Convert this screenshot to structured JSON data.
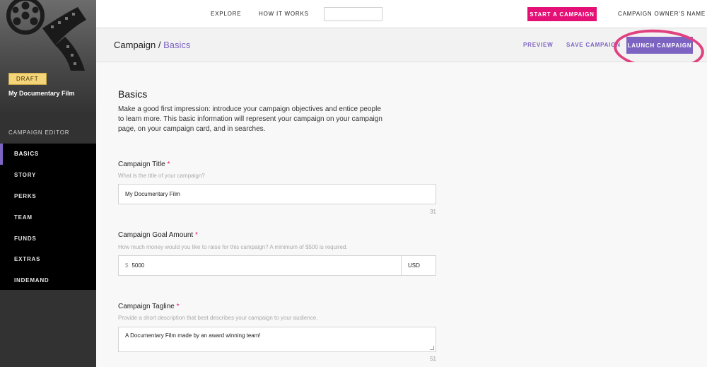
{
  "sidebar": {
    "status_badge": "DRAFT",
    "campaign_name": "My Documentary Film",
    "editor_heading": "CAMPAIGN EDITOR",
    "items": [
      {
        "label": "BASICS",
        "active": true
      },
      {
        "label": "STORY",
        "active": false
      },
      {
        "label": "PERKS",
        "active": false
      },
      {
        "label": "TEAM",
        "active": false
      },
      {
        "label": "FUNDS",
        "active": false
      },
      {
        "label": "EXTRAS",
        "active": false
      },
      {
        "label": "INDEMAND",
        "active": false
      }
    ]
  },
  "topbar": {
    "explore": "EXPLORE",
    "how_it_works": "HOW IT WORKS",
    "search_value": "",
    "start_campaign": "START A CAMPAIGN",
    "owner_name": "CAMPAIGN OWNER'S NAME"
  },
  "subheader": {
    "crumb_root": "Campaign",
    "crumb_sep": " / ",
    "crumb_current": "Basics",
    "preview": "PREVIEW",
    "save": "SAVE CAMPAIGN",
    "launch": "LAUNCH CAMPAIGN"
  },
  "main": {
    "title": "Basics",
    "description": "Make a good first impression: introduce your campaign objectives and entice people to learn more. This basic information will represent your campaign on your campaign page, on your campaign card, and in searches.",
    "fields": {
      "title": {
        "label": "Campaign Title",
        "required": "*",
        "help": "What is the title of your campaign?",
        "value": "My Documentary Film",
        "counter": "31"
      },
      "goal": {
        "label": "Campaign Goal Amount",
        "required": "*",
        "help": "How much money would you like to raise for this campaign? A minimum of $500 is required.",
        "currency_symbol": "$",
        "value": "5000",
        "currency": "USD"
      },
      "tagline": {
        "label": "Campaign Tagline",
        "required": "*",
        "help": "Provide a short description that best describes your campaign to your audience.",
        "value": "A Documentary Film made by an award winning team!",
        "counter": "51"
      }
    }
  },
  "colors": {
    "accent": "#7d64c2",
    "start_button": "#e51075",
    "highlight_ring": "#e0417f",
    "draft_badge": "#f5d57a"
  },
  "icons": {
    "sidebar_art": "film-reel-icon",
    "resize": "resize-grip-icon"
  }
}
